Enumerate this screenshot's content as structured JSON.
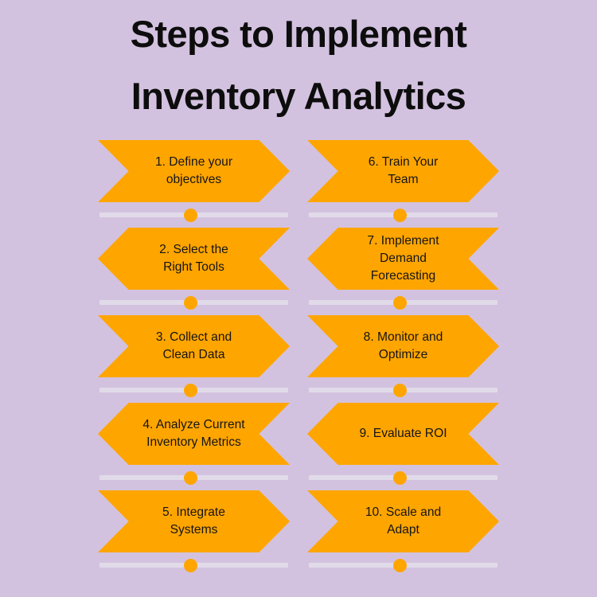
{
  "page": {
    "background_color": "#d3c2df",
    "accent_color": "#ffa500",
    "connector_bar_color": "#e1dbe9",
    "text_color": "#151515"
  },
  "header": {
    "title_line_1": "Steps to Implement",
    "title_line_2": "Inventory Analytics",
    "title_full": "Steps to Implement Inventory Analytics"
  },
  "infographic": {
    "type": "chevron-step-list",
    "columns": [
      {
        "name": "left-column",
        "steps": [
          {
            "number": "1.",
            "label": "1. Define your objectives",
            "lines": [
              "1. Define your",
              "objectives"
            ],
            "direction": "right"
          },
          {
            "number": "2.",
            "label": "2. Select the Right Tools",
            "lines": [
              "2. Select the",
              "Right Tools"
            ],
            "direction": "left"
          },
          {
            "number": "3.",
            "label": "3. Collect and Clean Data",
            "lines": [
              "3. Collect and",
              "Clean Data"
            ],
            "direction": "right"
          },
          {
            "number": "4.",
            "label": "4. Analyze Current Inventory Metrics",
            "lines": [
              "4. Analyze Current",
              "Inventory Metrics"
            ],
            "direction": "left"
          },
          {
            "number": "5.",
            "label": "5. Integrate Systems",
            "lines": [
              "5. Integrate",
              "Systems"
            ],
            "direction": "right"
          }
        ]
      },
      {
        "name": "right-column",
        "steps": [
          {
            "number": "6.",
            "label": "6. Train Your Team",
            "lines": [
              "6. Train Your",
              "Team"
            ],
            "direction": "right"
          },
          {
            "number": "7.",
            "label": "7. Implement Demand Forecasting",
            "lines": [
              "7. Implement",
              "Demand",
              "Forecasting"
            ],
            "direction": "left"
          },
          {
            "number": "8.",
            "label": "8. Monitor and Optimize",
            "lines": [
              "8. Monitor and",
              "Optimize"
            ],
            "direction": "right"
          },
          {
            "number": "9.",
            "label": "9. Evaluate ROI",
            "lines": [
              "9. Evaluate ROI"
            ],
            "direction": "left"
          },
          {
            "number": "10.",
            "label": "10. Scale and Adapt",
            "lines": [
              "10. Scale and",
              "Adapt"
            ],
            "direction": "right"
          }
        ]
      }
    ]
  }
}
